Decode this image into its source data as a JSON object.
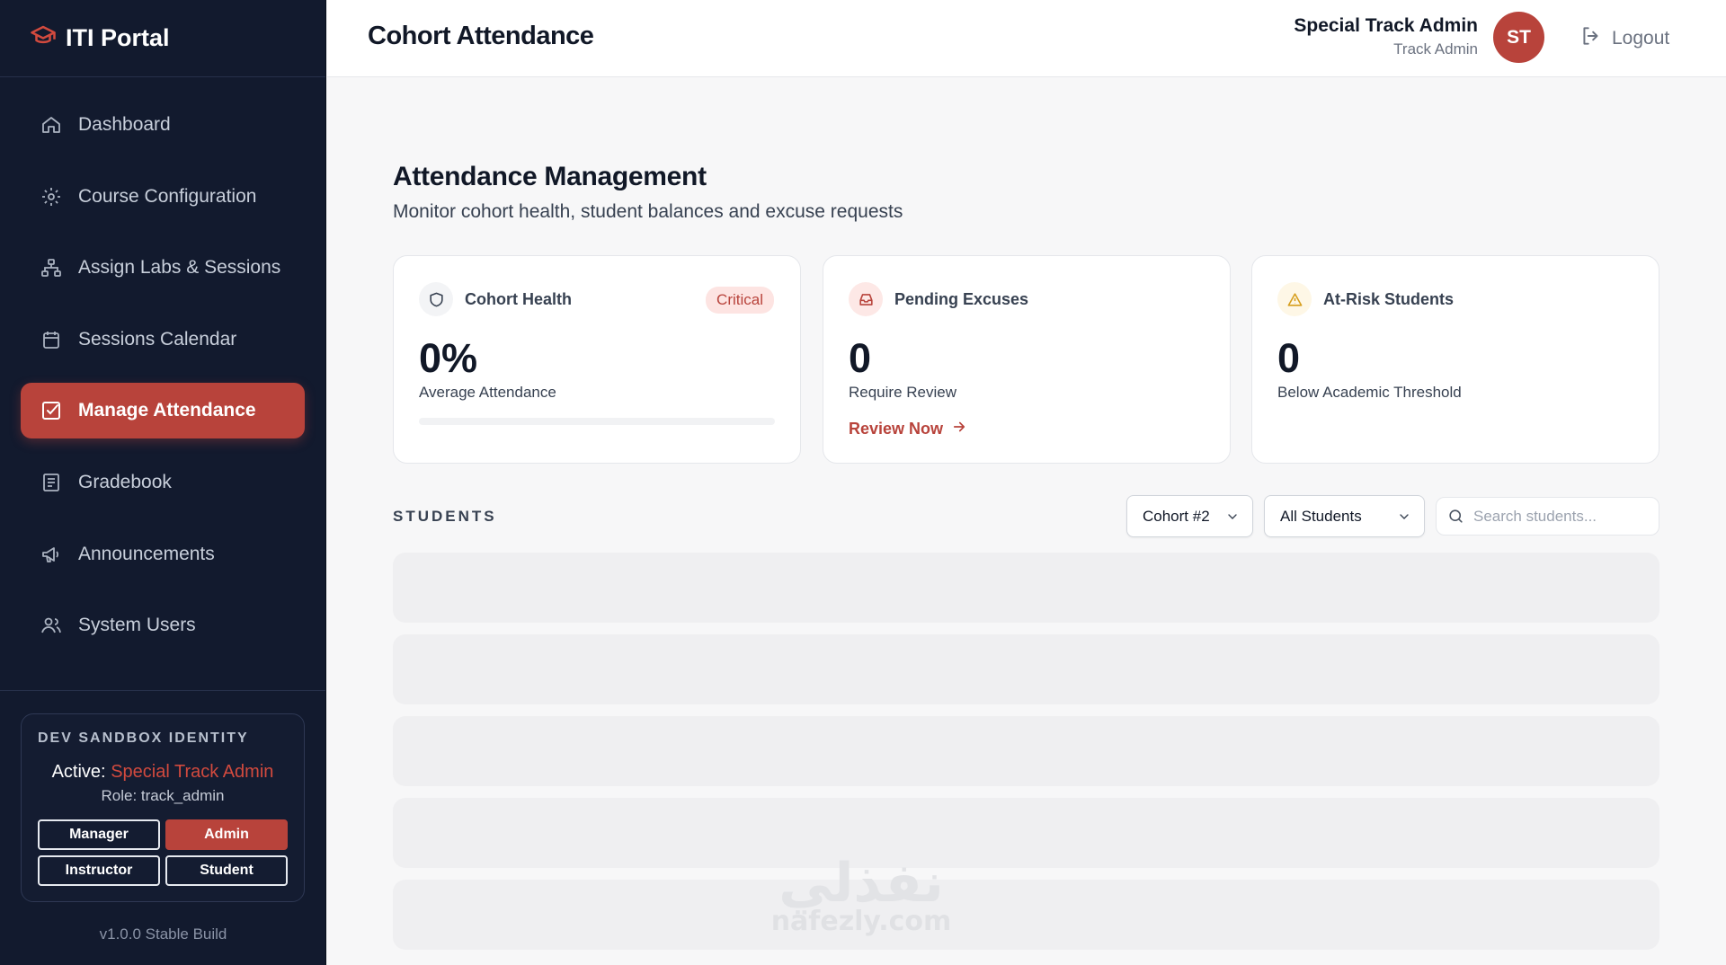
{
  "brand": {
    "name": "ITI Portal",
    "icon": "graduation-cap-icon"
  },
  "sidebar": {
    "items": [
      {
        "label": "Dashboard",
        "icon": "home-icon",
        "active": false
      },
      {
        "label": "Course Configuration",
        "icon": "gear-icon",
        "active": false
      },
      {
        "label": "Assign Labs & Sessions",
        "icon": "hierarchy-icon",
        "active": false
      },
      {
        "label": "Sessions Calendar",
        "icon": "calendar-icon",
        "active": false
      },
      {
        "label": "Manage Attendance",
        "icon": "checkbox-icon",
        "active": true
      },
      {
        "label": "Gradebook",
        "icon": "book-icon",
        "active": false
      },
      {
        "label": "Announcements",
        "icon": "megaphone-icon",
        "active": false
      },
      {
        "label": "System Users",
        "icon": "users-icon",
        "active": false
      }
    ],
    "sandbox": {
      "title": "DEV SANDBOX IDENTITY",
      "active_prefix": "Active:",
      "active_name": "Special Track Admin",
      "role_text": "Role: track_admin",
      "roles": [
        {
          "label": "Manager",
          "active": false
        },
        {
          "label": "Admin",
          "active": true
        },
        {
          "label": "Instructor",
          "active": false
        },
        {
          "label": "Student",
          "active": false
        }
      ]
    },
    "version": "v1.0.0 Stable Build"
  },
  "header": {
    "title": "Cohort Attendance",
    "user_name": "Special Track Admin",
    "user_role": "Track Admin",
    "avatar_initials": "ST",
    "logout_label": "Logout"
  },
  "main": {
    "heading": "Attendance Management",
    "subheading": "Monitor cohort health, student balances and excuse requests",
    "cards": {
      "cohort_health": {
        "label": "Cohort Health",
        "badge": "Critical",
        "value": "0%",
        "caption": "Average Attendance",
        "progress": 0
      },
      "pending_excuses": {
        "label": "Pending Excuses",
        "value": "0",
        "caption": "Require Review",
        "link": "Review Now"
      },
      "at_risk": {
        "label": "At-Risk Students",
        "value": "0",
        "caption": "Below Academic Threshold"
      }
    },
    "students": {
      "section_label": "STUDENTS",
      "cohort_select": "Cohort #2",
      "filter_select": "All Students",
      "search_placeholder": "Search students..."
    }
  },
  "watermark": {
    "arabic": "نفذلي",
    "latin": "nafezly.com"
  },
  "colors": {
    "accent": "#b8433b",
    "sidebar_bg": "#121a2e",
    "page_bg": "#f7f7f8"
  }
}
